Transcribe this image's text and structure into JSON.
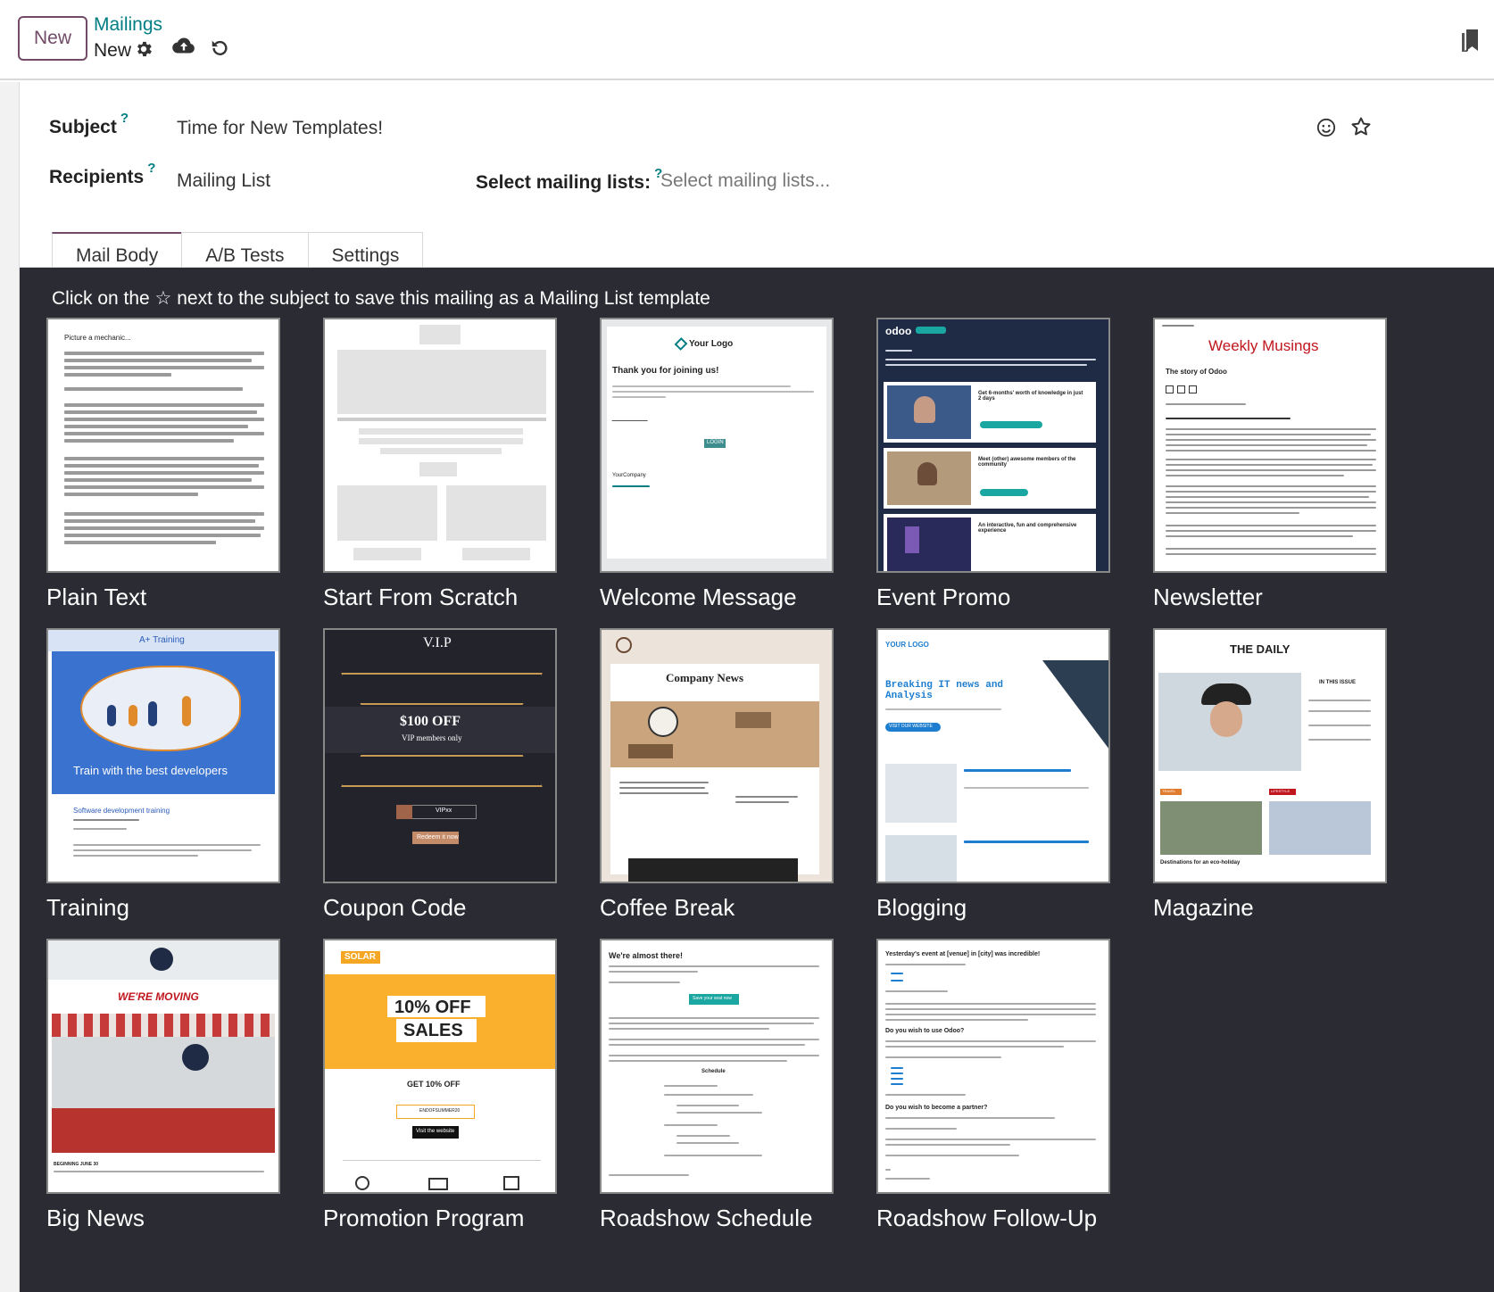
{
  "control_panel": {
    "new_button": "New",
    "breadcrumb": "Mailings",
    "record_name": "New"
  },
  "form": {
    "subject_label": "Subject",
    "subject_value": "Time for New Templates!",
    "recipients_label": "Recipients",
    "recipients_value": "Mailing List",
    "mailing_lists_label": "Select mailing lists:",
    "mailing_lists_placeholder": "Select mailing lists...",
    "help_mark": "?"
  },
  "tabs": [
    "Mail Body",
    "A/B Tests",
    "Settings"
  ],
  "hint": "Click on the ☆ next to the subject to save this mailing as a Mailing List template",
  "templates": [
    "Plain Text",
    "Start From Scratch",
    "Welcome Message",
    "Event Promo",
    "Newsletter",
    "Training",
    "Coupon Code",
    "Coffee Break",
    "Blogging",
    "Magazine",
    "Big News",
    "Promotion Program",
    "Roadshow Schedule",
    "Roadshow Follow-Up"
  ],
  "thumb_text": {
    "plain_heading": "Picture a mechanic...",
    "welcome_logo": "Your Logo",
    "welcome_heading": "Thank you for joining us!",
    "welcome_button": "LOGIN",
    "welcome_company": "YourCompany",
    "event_logo": "odoo",
    "event_item1": "Get 6-months' worth of knowledge in just 2 days",
    "event_item2": "Meet (other) awesome members of the community",
    "event_item3": "An interactive, fun and comprehensive experience",
    "news_title": "Weekly Musings",
    "news_sub": "The story of Odoo",
    "training_brand": "A+ Training",
    "training_banner": "Train with the best developers",
    "training_course": "Software development training",
    "coupon_vip": "V.I.P",
    "coupon_off": "$100 OFF",
    "coupon_members": "VIP members only",
    "coupon_code": "VIPxx",
    "coupon_redeem": "Redeem it now",
    "coffee_title": "Company News",
    "blog_logo": "YOUR LOGO",
    "blog_heading": "Breaking IT news and Analysis",
    "blog_button": "VISIT OUR WEBSITE",
    "mag_title": "THE DAILY",
    "mag_issue": "IN THIS ISSUE",
    "mag_travel": "TRAVEL",
    "mag_lifestyle": "LIFESTYLE",
    "mag_dest": "Destinations for an eco-holiday",
    "big_moving": "WE'RE MOVING",
    "big_date": "BEGINNING JUNE 30",
    "promo_brand": "SOLAR",
    "promo_off": "10% OFF",
    "promo_sales": "SALES",
    "promo_get": "GET 10% OFF",
    "promo_code": "ENDOFSUMMER20",
    "promo_visit": "Visit the website",
    "road_heading": "We're almost there!",
    "road_button": "Save your seat now",
    "road_schedule": "Schedule",
    "follow_heading": "Yesterday's event at [venue] in [city] was incredible!",
    "follow_q1": "Do you wish to use Odoo?",
    "follow_q2": "Do you wish to become a partner?"
  },
  "colors": {
    "primary": "#714b67",
    "link": "#017e84",
    "panel_bg": "#2b2c33"
  }
}
